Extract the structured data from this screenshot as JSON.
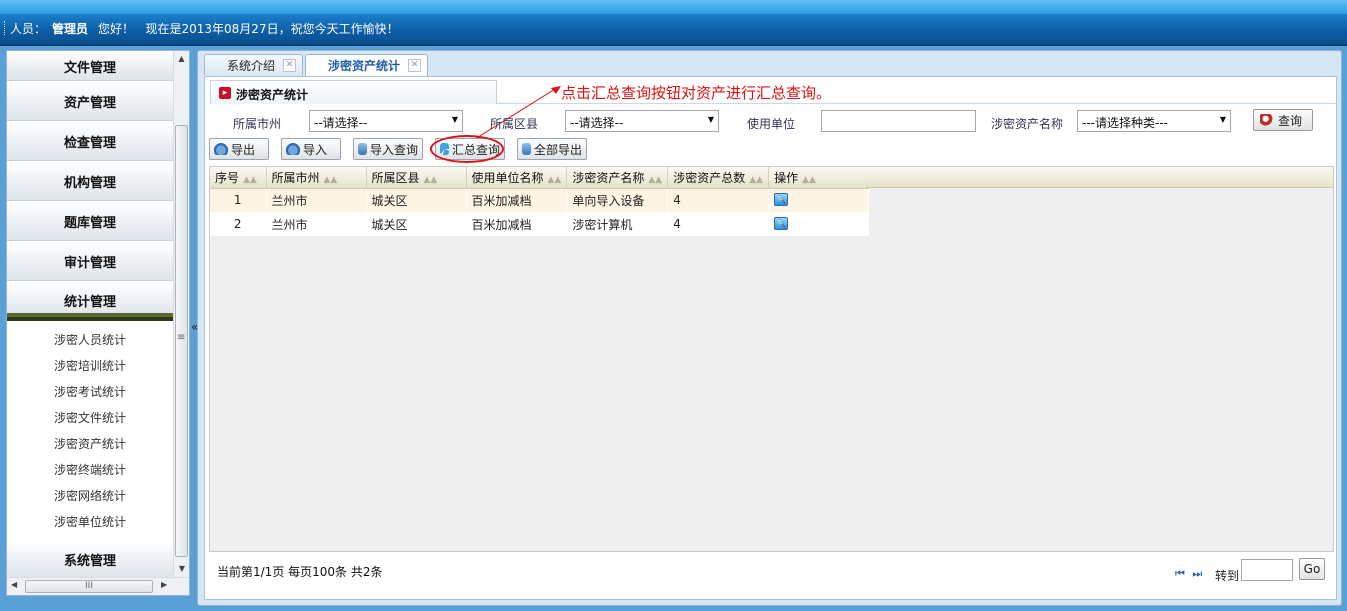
{
  "header": {
    "label": "人员：",
    "user": "管理员",
    "greeting": "您好！",
    "message": "现在是2013年08月27日，祝您今天工作愉快！"
  },
  "sidebar": {
    "menus": [
      "文件管理",
      "资产管理",
      "检查管理",
      "机构管理",
      "题库管理",
      "审计管理",
      "统计管理"
    ],
    "submenu": [
      "涉密人员统计",
      "涉密培训统计",
      "涉密考试统计",
      "涉密文件统计",
      "涉密资产统计",
      "涉密终端统计",
      "涉密网络统计",
      "涉密单位统计"
    ],
    "last_menu": "系统管理",
    "collapse_glyph": "«"
  },
  "tabs": [
    {
      "label": "系统介绍",
      "active": false
    },
    {
      "label": "涉密资产统计",
      "active": true
    }
  ],
  "panel": {
    "title": "涉密资产统计"
  },
  "annotation": "点击汇总查询按钮对资产进行汇总查询。",
  "filters": {
    "city_label": "所属市州",
    "city_value": "--请选择--",
    "county_label": "所属区县",
    "county_value": "--请选择--",
    "unit_label": "使用单位",
    "unit_value": "",
    "asset_label": "涉密资产名称",
    "asset_value": "---请选择种类---",
    "query_label": "查询"
  },
  "toolbar": {
    "export": "导出",
    "import": "导入",
    "import_query": "导入查询",
    "summary_query": "汇总查询",
    "export_all": "全部导出"
  },
  "grid": {
    "columns": [
      "序号",
      "所属市州",
      "所属区县",
      "使用单位名称",
      "涉密资产名称",
      "涉密资产总数",
      "操作"
    ],
    "rows": [
      [
        "1",
        "兰州市",
        "城关区",
        "百米加减档",
        "单向导入设备",
        "4"
      ],
      [
        "2",
        "兰州市",
        "城关区",
        "百米加减档",
        "涉密计算机",
        "4"
      ]
    ]
  },
  "pager": {
    "info": "当前第1/1页  每页100条  共2条",
    "goto_label": "转到",
    "go_label": "Go",
    "nav_glyphs": "⏮ ⏭"
  },
  "colors": {
    "accent": "#1f5fa8",
    "annotation": "#e01010",
    "header": "#1a7dc8"
  }
}
